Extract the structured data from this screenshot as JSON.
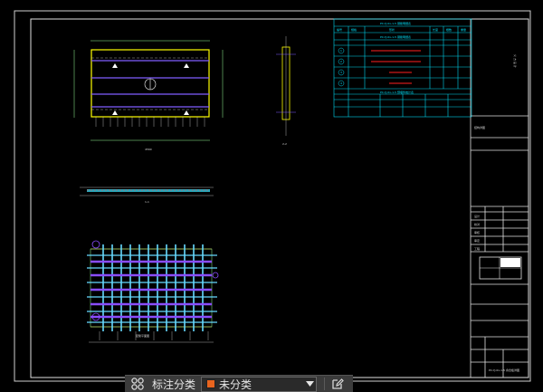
{
  "drawing": {
    "title_block_vertical_text": "义 方 设 计",
    "sheet_label": "结构详图",
    "dim_overall": "4560",
    "dim_section": "2-2",
    "dim_side": "1-1",
    "plan_caption": "配筋平面图",
    "table": {
      "header": "PC-YJ-0x-1-5 钢筋明细表",
      "subheader": "PC-YJ-0x-1-5 钢筋明细表",
      "footer": "PC-YJ-0x-1-5 预埋件统计表",
      "col_headers": [
        "编号",
        "规格",
        "形状",
        "长度",
        "根数",
        "重量"
      ],
      "rows": [
        "1",
        "2",
        "3",
        "4"
      ]
    },
    "title_block_rows": [
      "设计",
      "校对",
      "审核",
      "审定",
      "工程"
    ],
    "bottom_right_text": "PC-YJ-0x-1-5 叠合板详图"
  },
  "toolbar": {
    "tools_icon": "grid-icon",
    "annotation_label": "标注分类",
    "category_value": "未分类",
    "category_color": "#e8641e",
    "edit_icon": "edit-icon"
  }
}
